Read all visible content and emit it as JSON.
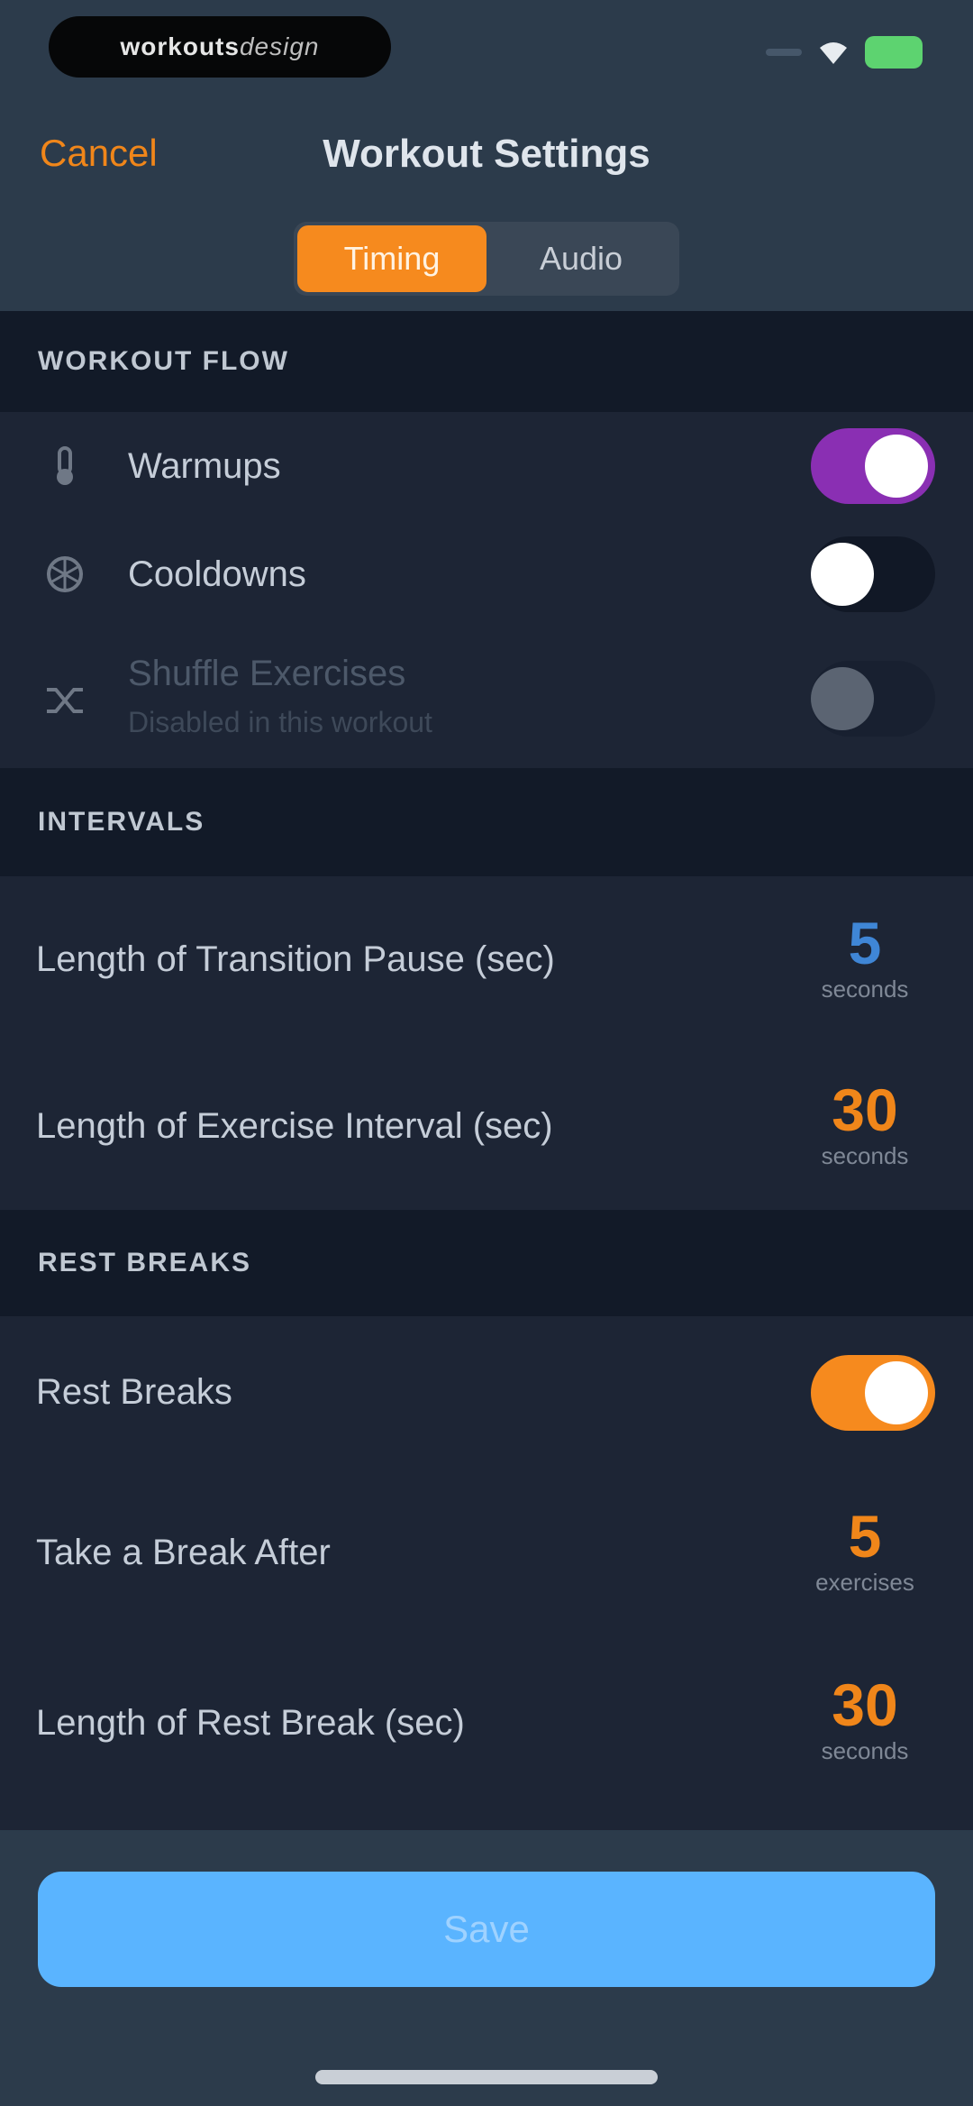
{
  "status_bar": {
    "pill_brand_primary": "workouts",
    "pill_brand_secondary": "design"
  },
  "nav": {
    "cancel_label": "Cancel",
    "title": "Workout Settings"
  },
  "tabs": [
    {
      "label": "Timing",
      "active": true
    },
    {
      "label": "Audio",
      "active": false
    }
  ],
  "workout_flow": {
    "header": "WORKOUT FLOW",
    "warmups": {
      "label": "Warmups",
      "on": true,
      "icon": "thermometer-icon"
    },
    "cooldowns": {
      "label": "Cooldowns",
      "on": false,
      "icon": "snowflake-icon"
    },
    "shuffle": {
      "label": "Shuffle Exercises",
      "sublabel": "Disabled in this workout",
      "on": false,
      "enabled": false,
      "icon": "shuffle-icon"
    }
  },
  "intervals": {
    "header": "INTERVALS",
    "transition": {
      "label": "Length of Transition Pause (sec)",
      "value": "5",
      "unit": "seconds",
      "color": "#3f86d6"
    },
    "exercise": {
      "label": "Length of Exercise Interval (sec)",
      "value": "30",
      "unit": "seconds",
      "color": "#f0861a"
    }
  },
  "rest_breaks": {
    "header": "REST BREAKS",
    "toggle": {
      "label": "Rest Breaks",
      "on": true
    },
    "after": {
      "label": "Take a Break After",
      "value": "5",
      "unit": "exercises",
      "color": "#f0861a"
    },
    "length": {
      "label": "Length of Rest Break (sec)",
      "value": "30",
      "unit": "seconds",
      "color": "#f0861a"
    }
  },
  "footer": {
    "save_label": "Save"
  },
  "colors": {
    "accent": "#f68a1e",
    "purple": "#8a2fb3",
    "blue": "#5ab4ff"
  }
}
